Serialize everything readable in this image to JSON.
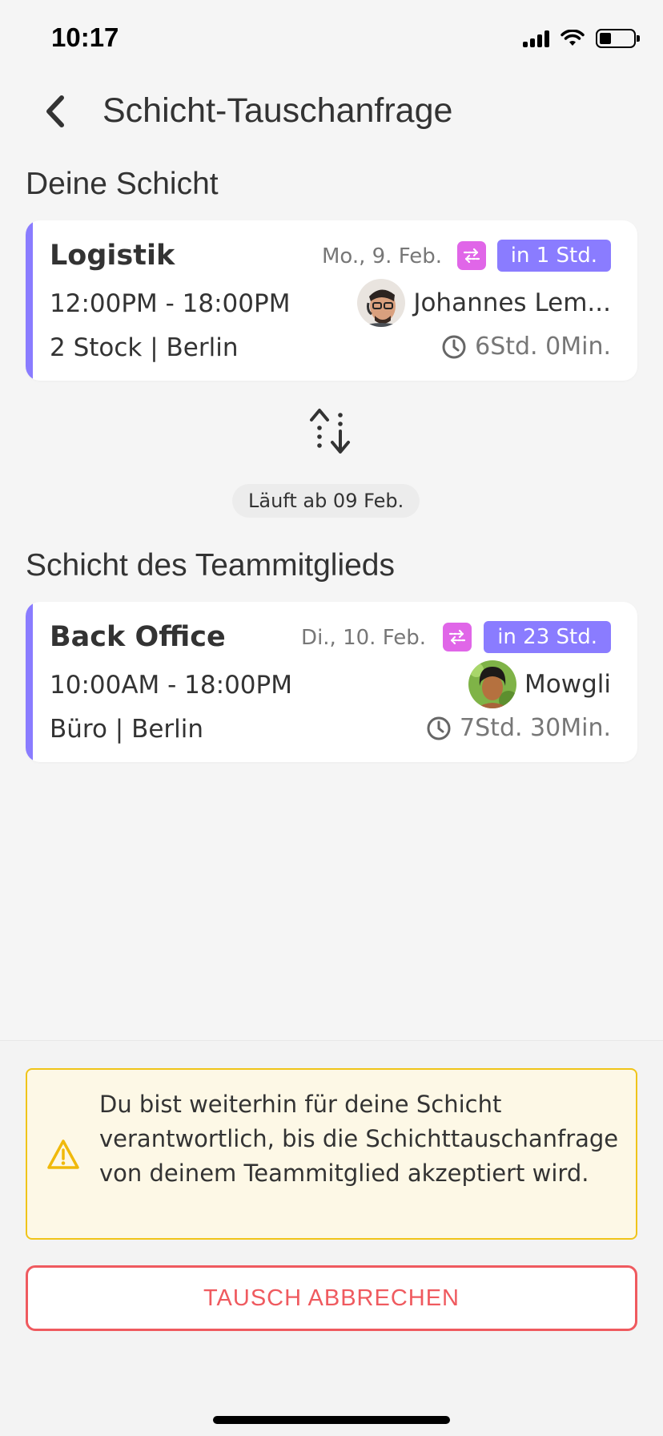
{
  "status_bar": {
    "time": "10:17"
  },
  "header": {
    "title": "Schicht-Tauschanfrage"
  },
  "sections": {
    "own": "Deine Schicht",
    "teammate": "Schicht des Teammitglieds"
  },
  "own_shift": {
    "title": "Logistik",
    "date": "Mo., 9. Feb.",
    "badge": "in 1 Std.",
    "time": "12:00PM - 18:00PM",
    "person": "Johannes Lem...",
    "location": "2 Stock | Berlin",
    "duration": "6Std. 0Min."
  },
  "expiry": "Läuft ab 09 Feb.",
  "teammate_shift": {
    "title": "Back Office",
    "date": "Di., 10. Feb.",
    "badge": "in 23 Std.",
    "time": "10:00AM - 18:00PM",
    "person": "Mowgli",
    "location": "Büro | Berlin",
    "duration": "7Std. 30Min."
  },
  "notice": "Du bist weiterhin für deine Schicht verantwortlich, bis die Schichttauschanfrage von deinem Teammitglied akzeptiert wird.",
  "cancel_button": "TAUSCH ABBRECHEN",
  "colors": {
    "accent": "#8a7cff",
    "swap": "#e066e8",
    "danger": "#ef5a5f",
    "warning": "#f0c419"
  }
}
